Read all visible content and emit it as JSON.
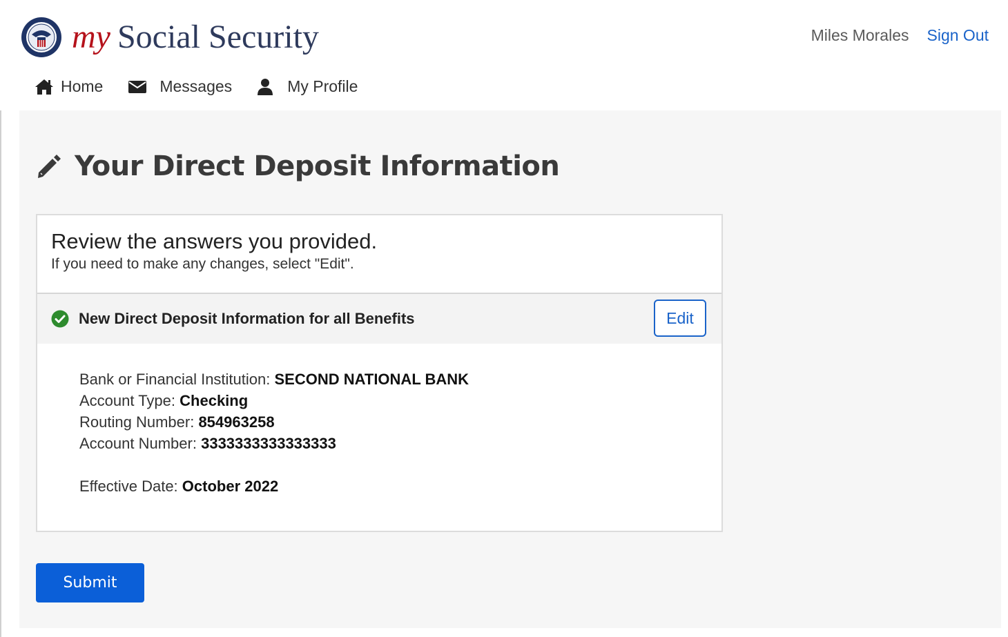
{
  "header": {
    "brand_my": "my",
    "brand_rest": "Social Security",
    "user_name": "Miles Morales",
    "sign_out": "Sign Out"
  },
  "nav": {
    "items": [
      {
        "label": "Home",
        "icon": "home-icon"
      },
      {
        "label": "Messages",
        "icon": "envelope-icon"
      },
      {
        "label": "My Profile",
        "icon": "user-icon"
      }
    ]
  },
  "page": {
    "title": "Your Direct Deposit Information",
    "title_icon": "pencil-icon"
  },
  "review": {
    "title": "Review the answers you provided.",
    "subtitle": "If you need to make any changes, select \"Edit\".",
    "section_label": "New Direct Deposit Information for all Benefits",
    "section_icon": "check-circle-icon",
    "edit_label": "Edit",
    "fields": [
      {
        "label": "Bank or Financial Institution:",
        "value": "SECOND NATIONAL BANK"
      },
      {
        "label": "Account Type:",
        "value": "Checking"
      },
      {
        "label": "Routing Number:",
        "value": "854963258"
      },
      {
        "label": "Account Number:",
        "value": "3333333333333333"
      }
    ],
    "effective": {
      "label": "Effective Date:",
      "value": "October 2022"
    }
  },
  "actions": {
    "submit_label": "Submit"
  },
  "colors": {
    "brand_red": "#b5121b",
    "link_blue": "#1a63c9",
    "primary_button": "#0b5fd8",
    "check_green": "#2e8b2e",
    "main_background": "#f6f6f6"
  }
}
